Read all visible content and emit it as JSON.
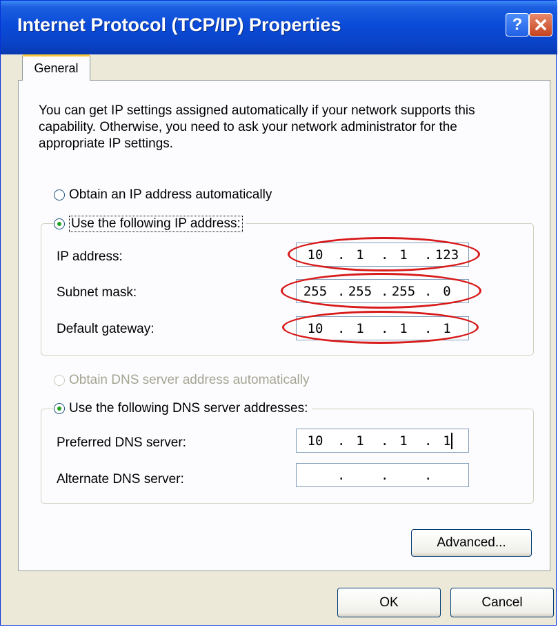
{
  "window": {
    "title": "Internet Protocol (TCP/IP) Properties"
  },
  "titlebar": {
    "help_icon": "help-icon",
    "close_icon": "close-icon",
    "help_glyph": "?"
  },
  "tabs": [
    {
      "label": "General",
      "selected": true
    }
  ],
  "intro_text": "You can get IP settings assigned automatically if your network supports this capability. Otherwise, you need to ask your network administrator for the appropriate IP settings.",
  "ip": {
    "auto_label": "Obtain an IP address automatically",
    "auto_selected": false,
    "manual_label": "Use the following IP address:",
    "manual_selected": true,
    "fields": [
      {
        "label": "IP address:",
        "octets": [
          "10",
          "1",
          "1",
          "123"
        ]
      },
      {
        "label": "Subnet mask:",
        "octets": [
          "255",
          "255",
          "255",
          "0"
        ]
      },
      {
        "label": "Default gateway:",
        "octets": [
          "10",
          "1",
          "1",
          "1"
        ]
      }
    ]
  },
  "dns": {
    "auto_label": "Obtain DNS server address automatically",
    "auto_selected": false,
    "auto_disabled": true,
    "manual_label": "Use the following DNS server addresses:",
    "manual_selected": true,
    "fields": [
      {
        "label": "Preferred DNS server:",
        "octets": [
          "10",
          "1",
          "1",
          "1"
        ]
      },
      {
        "label": "Alternate DNS server:",
        "octets": [
          "",
          "",
          "",
          ""
        ]
      }
    ]
  },
  "buttons": {
    "advanced": "Advanced...",
    "ok": "OK",
    "cancel": "Cancel"
  },
  "colors": {
    "highlight_ellipse": "#d81a1a",
    "titlebar": "#0a4bd8",
    "dialog_bg": "#ece9d8"
  }
}
